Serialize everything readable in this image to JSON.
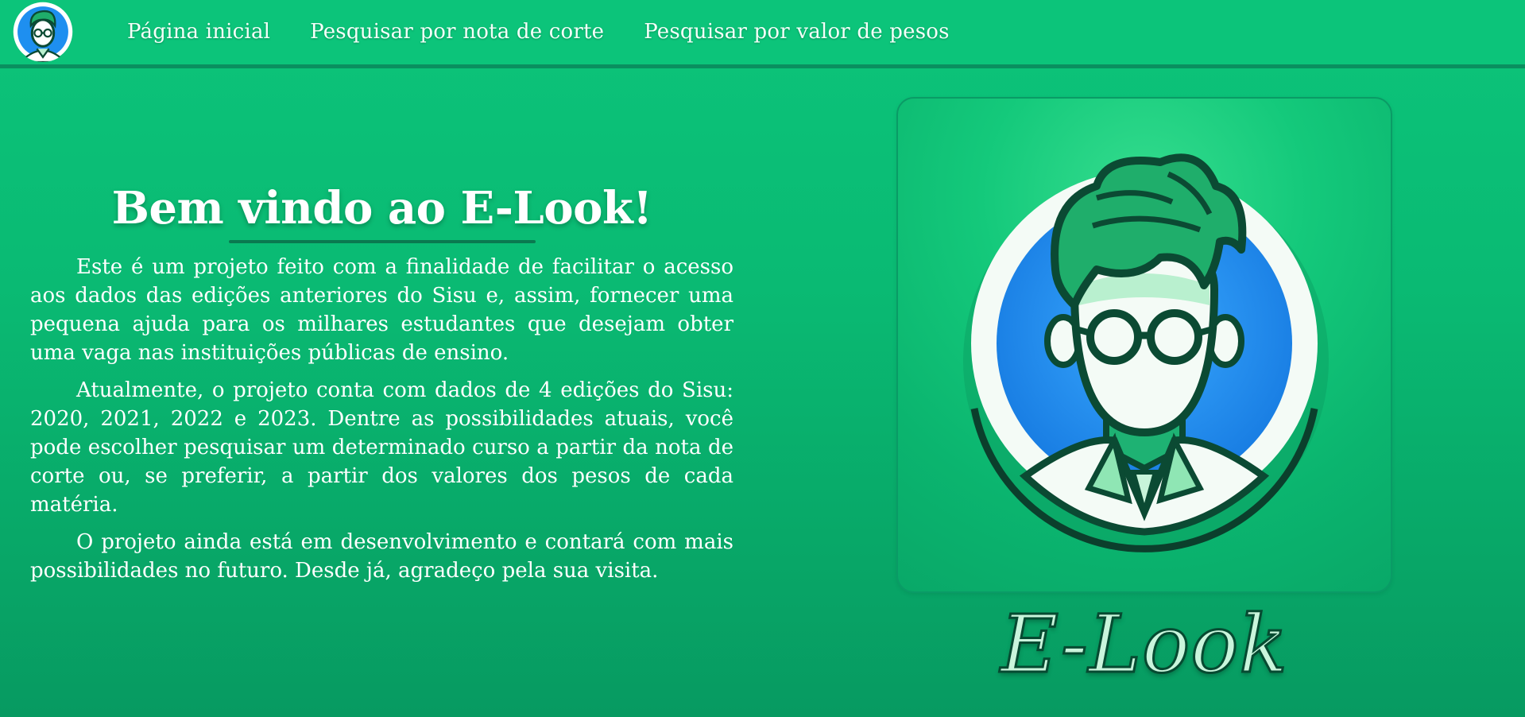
{
  "nav": {
    "logo_icon": "avatar-logo-icon",
    "links": [
      {
        "label": "Página inicial"
      },
      {
        "label": "Pesquisar por nota de corte"
      },
      {
        "label": "Pesquisar por valor de pesos"
      }
    ]
  },
  "main": {
    "title": "Bem vindo ao E-Look!",
    "paragraphs": [
      "Este é um projeto feito com a finalidade de facilitar o acesso aos dados das edições anteriores do Sisu e, assim, fornecer uma pequena ajuda para os milhares estudantes que desejam obter uma vaga nas instituições públicas de ensino.",
      "Atualmente, o projeto conta com dados de 4 edições do Sisu: 2020, 2021, 2022 e 2023. Dentre as possibilidades atuais, você pode escolher pesquisar um determinado curso a partir da nota de corte ou, se preferir, a partir dos valores dos pesos de cada matéria.",
      "O projeto ainda está em desenvolvimento e contará com mais possibilidades no futuro. Desde já, agradeço pela sua visita."
    ]
  },
  "brand": {
    "name": "E-Look",
    "logo_icon": "avatar-logo-icon"
  },
  "colors": {
    "background": "#0cc47a",
    "nav_border": "#0a8f5f",
    "accent_dark": "#064a31",
    "avatar_blue": "#1e8ff0"
  }
}
